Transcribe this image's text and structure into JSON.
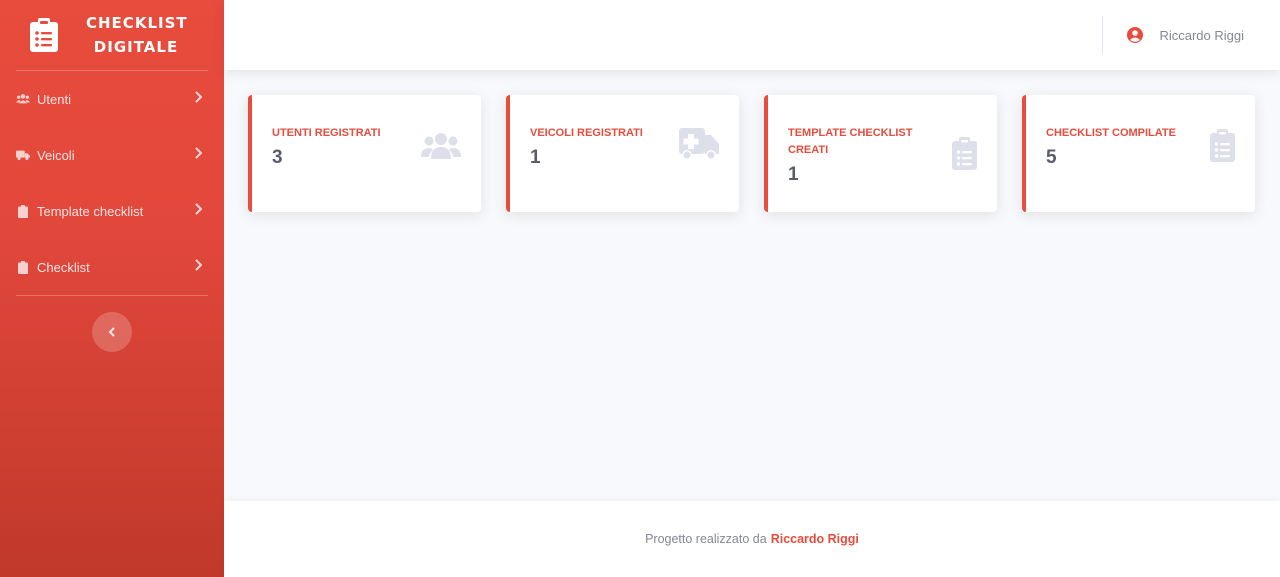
{
  "app": {
    "brand_line1": "CHECKLIST",
    "brand_line2": "DIGITALE",
    "accent_color": "#e74c3c"
  },
  "sidebar": {
    "items": [
      {
        "label": "Utenti",
        "icon": "users-icon"
      },
      {
        "label": "Veicoli",
        "icon": "truck-icon"
      },
      {
        "label": "Template checklist",
        "icon": "clipboard-icon"
      },
      {
        "label": "Checklist",
        "icon": "clipboard-icon"
      }
    ],
    "toggle_icon": "chevron-left-icon"
  },
  "topbar": {
    "user_name": "Riccardo Riggi",
    "user_icon": "user-circle-icon"
  },
  "cards": [
    {
      "title": "UTENTI REGISTRATI",
      "value": "3",
      "icon": "users-icon"
    },
    {
      "title": "VEICOLI REGISTRATI",
      "value": "1",
      "icon": "ambulance-icon"
    },
    {
      "title": "TEMPLATE CHECKLIST CREATI",
      "value": "1",
      "icon": "clipboard-list-icon"
    },
    {
      "title": "CHECKLIST COMPILATE",
      "value": "5",
      "icon": "clipboard-list-icon"
    }
  ],
  "footer": {
    "text": "Progetto realizzato da",
    "author": "Riccardo Riggi"
  }
}
